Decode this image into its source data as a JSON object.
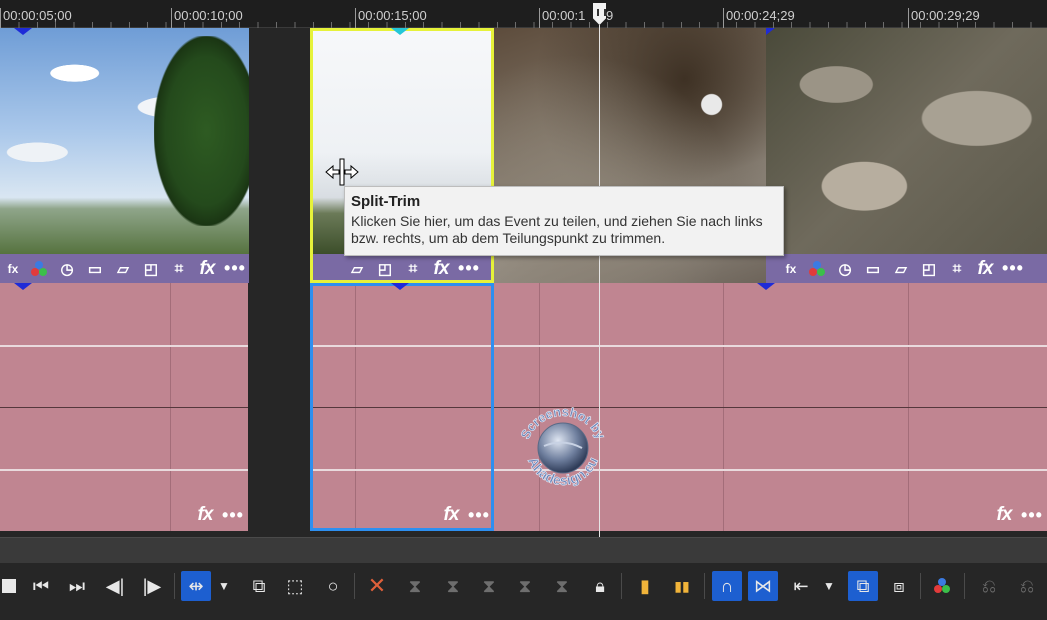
{
  "ruler": {
    "labels": [
      "00:00:05;00",
      "00:00:10;00",
      "00:00:15;00",
      "00:00:1",
      "9",
      "00:00:24;29",
      "00:00:29;29"
    ]
  },
  "tooltip": {
    "title": "Split-Trim",
    "body": "Klicken Sie hier, um das Event zu teilen, und ziehen Sie nach links bzw. rechts, um ab dem Teilungspunkt zu trimmen."
  },
  "fx_label": "fx",
  "more_label": "•••",
  "watermark": {
    "top_text": "Screenshot by",
    "bottom_text": "Ahadesign.eu"
  },
  "colors": {
    "video_event_bar": "#7a6aa4",
    "audio_event": "#c08591",
    "selection_yellow": "#e6f23a",
    "selection_blue": "#2d8ff0",
    "active_tool": "#1d5fd0",
    "delete_icon": "#e0603a",
    "marker_yellow": "#f1b43a"
  },
  "toolbar": {
    "buttons": [
      "stop",
      "prev-event",
      "next-event",
      "prev-frame",
      "next-frame",
      "split-trim",
      "edit-tool-dropdown",
      "group",
      "selection-rect",
      "zoom",
      "delete",
      "trim-start",
      "trim-end",
      "split",
      "trim",
      "lock",
      "marker",
      "region",
      "snapping",
      "auto-crossfade",
      "ripple",
      "ripple-dropdown",
      "lock-envelopes",
      "ignore-grouping",
      "compositing",
      "undo",
      "redo"
    ]
  }
}
